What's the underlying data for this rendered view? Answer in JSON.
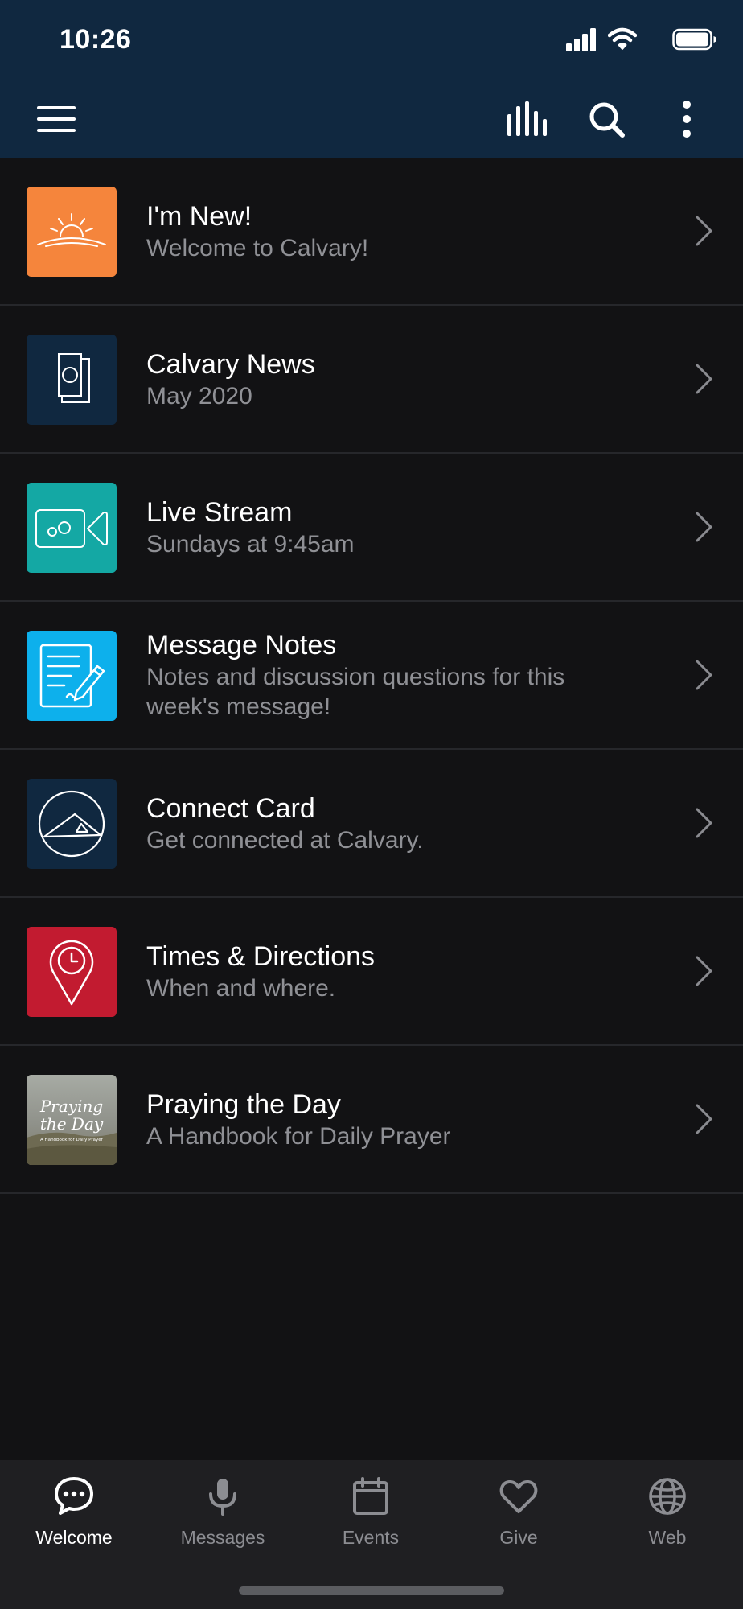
{
  "status_bar": {
    "time": "10:26"
  },
  "toolbar": {
    "menu_icon": "hamburger-menu-icon",
    "audio_icon": "audio-bars-icon",
    "search_icon": "search-icon",
    "more_icon": "more-vertical-icon",
    "background": "#102840"
  },
  "items": [
    {
      "title": "I'm New!",
      "subtitle": "Welcome to Calvary!",
      "icon": "sunrise-icon",
      "color": "#f5853c"
    },
    {
      "title": "Calvary News",
      "subtitle": "May 2020",
      "icon": "newsletter-icon",
      "color": "#102840"
    },
    {
      "title": "Live Stream",
      "subtitle": "Sundays at 9:45am",
      "icon": "video-camera-icon",
      "color": "#14a8a4"
    },
    {
      "title": "Message Notes",
      "subtitle": "Notes and discussion questions for this week's message!",
      "icon": "notepad-pen-icon",
      "color": "#0db0ec"
    },
    {
      "title": "Connect Card",
      "subtitle": "Get connected at Calvary.",
      "icon": "church-logo-icon",
      "color": "#102840"
    },
    {
      "title": "Times & Directions",
      "subtitle": "When and where.",
      "icon": "location-clock-icon",
      "color": "#c21b30"
    },
    {
      "title": "Praying the Day",
      "subtitle": "A Handbook for Daily Prayer",
      "icon": "book-cover-image",
      "cover_title": "Praying the Day",
      "cover_subtitle": "A Handbook for Daily Prayer"
    }
  ],
  "tabs": [
    {
      "label": "Welcome",
      "icon": "chat-bubble-icon",
      "active": true
    },
    {
      "label": "Messages",
      "icon": "microphone-icon",
      "active": false
    },
    {
      "label": "Events",
      "icon": "calendar-icon",
      "active": false
    },
    {
      "label": "Give",
      "icon": "heart-icon",
      "active": false
    },
    {
      "label": "Web",
      "icon": "globe-icon",
      "active": false
    }
  ]
}
